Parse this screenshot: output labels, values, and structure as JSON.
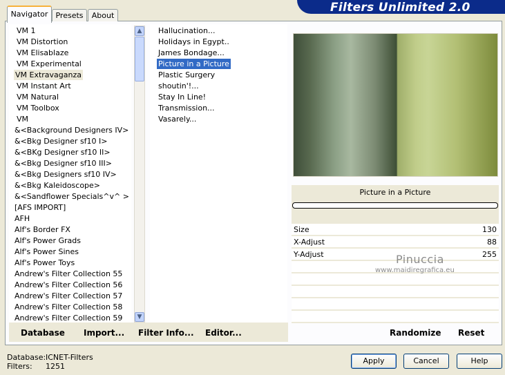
{
  "app_title": "Filters Unlimited 2.0",
  "tabs": [
    {
      "label": "Navigator",
      "active": true
    },
    {
      "label": "Presets",
      "active": false
    },
    {
      "label": "About",
      "active": false
    }
  ],
  "categories": [
    "VM 1",
    "VM Distortion",
    "VM Elisablaze",
    "VM Experimental",
    "VM Extravaganza",
    "VM Instant Art",
    "VM Natural",
    "VM Toolbox",
    "VM",
    "&<Background Designers IV>",
    "&<Bkg Designer sf10 I>",
    "&<BKg Designer sf10 II>",
    "&<Bkg Designer sf10 III>",
    "&<Bkg Designers sf10 IV>",
    "&<Bkg Kaleidoscope>",
    "&<Sandflower Specials^v^ >",
    "[AFS IMPORT]",
    "AFH",
    "Alf's Border FX",
    "Alf's Power Grads",
    "Alf's Power Sines",
    "Alf's Power Toys",
    "Andrew's Filter Collection 55",
    "Andrew's Filter Collection 56",
    "Andrew's Filter Collection 57",
    "Andrew's Filter Collection 58",
    "Andrew's Filter Collection 59"
  ],
  "selected_category": "VM Extravaganza",
  "filters": [
    "Hallucination...",
    "Holidays in Egypt..",
    "James Bondage...",
    "Picture in a Picture",
    "Plastic Surgery",
    "shoutin'!...",
    "Stay In Line!",
    "Transmission...",
    "Vasarely..."
  ],
  "selected_filter": "Picture in a Picture",
  "left_buttons": {
    "database": "Database",
    "import": "Import...",
    "filter_info": "Filter Info...",
    "editor": "Editor..."
  },
  "filter_title": "Picture in a Picture",
  "controls": [
    {
      "name": "Size",
      "value": "130"
    },
    {
      "name": "X-Adjust",
      "value": "88"
    },
    {
      "name": "Y-Adjust",
      "value": "255"
    }
  ],
  "watermark": {
    "name": "Pinuccia",
    "url": "www.maidiregrafica.eu"
  },
  "right_buttons": {
    "randomize": "Randomize",
    "reset": "Reset"
  },
  "status": {
    "database_label": "Database:",
    "database_value": "ICNET-Filters",
    "filters_label": "Filters:",
    "filters_value": "1251"
  },
  "dialog_buttons": {
    "apply": "Apply",
    "cancel": "Cancel",
    "help": "Help"
  },
  "colors": {
    "banner": "#0b2b8a",
    "selection": "#316ac5",
    "active_tab_accent": "#f7b13a"
  }
}
